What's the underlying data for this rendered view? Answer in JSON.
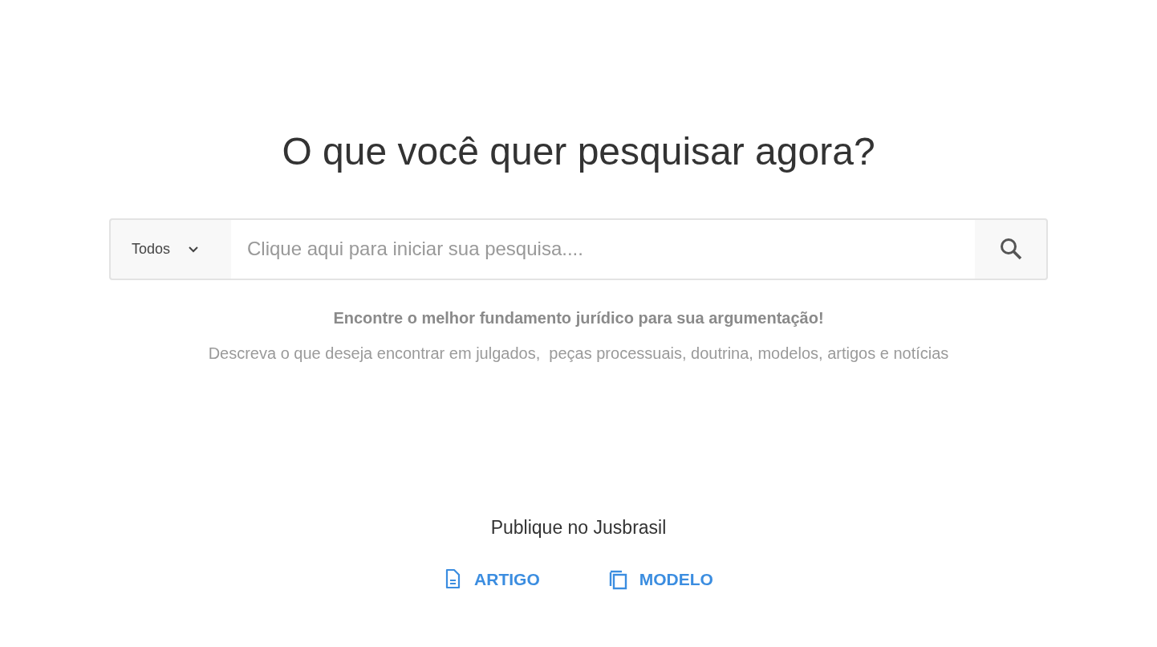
{
  "heading": "O que você quer pesquisar agora?",
  "search": {
    "scope": "Todos",
    "placeholder": "Clique aqui para iniciar sua pesquisa...."
  },
  "tagline": "Encontre o melhor fundamento jurídico para sua argumentação!",
  "description": "Descreva o que deseja encontrar em julgados,  peças processuais, doutrina, modelos, artigos e notícias",
  "publish": {
    "title": "Publique no Jusbrasil",
    "links": [
      {
        "label": "ARTIGO",
        "kind": "document"
      },
      {
        "label": "MODELO",
        "kind": "copy"
      }
    ]
  }
}
